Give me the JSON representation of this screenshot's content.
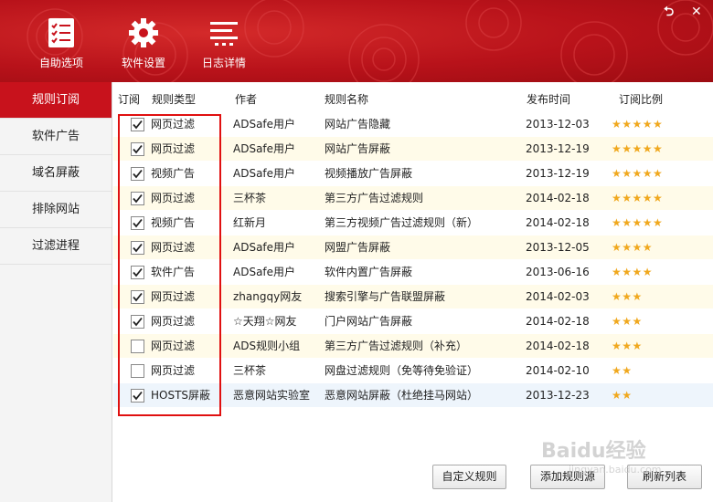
{
  "window": {
    "controls": {
      "restore": "⮌",
      "close": "✕"
    }
  },
  "toolbar": {
    "buttons": [
      {
        "label": "自助选项",
        "icon": "checklist-icon"
      },
      {
        "label": "软件设置",
        "icon": "gear-icon"
      },
      {
        "label": "日志详情",
        "icon": "list-log-icon"
      }
    ]
  },
  "sidebar": {
    "items": [
      {
        "label": "规则订阅",
        "active": true
      },
      {
        "label": "软件广告",
        "active": false
      },
      {
        "label": "域名屏蔽",
        "active": false
      },
      {
        "label": "排除网站",
        "active": false
      },
      {
        "label": "过滤进程",
        "active": false
      }
    ]
  },
  "table": {
    "headers": [
      "订阅",
      "规则类型",
      "作者",
      "规则名称",
      "发布时间",
      "订阅比例"
    ],
    "rows": [
      {
        "checked": true,
        "type": "网页过滤",
        "author": "ADSafe用户",
        "name": "网站广告隐藏",
        "date": "2013-12-03",
        "rating": "★★★★★"
      },
      {
        "checked": true,
        "type": "网页过滤",
        "author": "ADSafe用户",
        "name": "网站广告屏蔽",
        "date": "2013-12-19",
        "rating": "★★★★★"
      },
      {
        "checked": true,
        "type": "视频广告",
        "author": "ADSafe用户",
        "name": "视频播放广告屏蔽",
        "date": "2013-12-19",
        "rating": "★★★★★"
      },
      {
        "checked": true,
        "type": "网页过滤",
        "author": "三杯茶",
        "name": "第三方广告过滤规则",
        "date": "2014-02-18",
        "rating": "★★★★★"
      },
      {
        "checked": true,
        "type": "视频广告",
        "author": "红新月",
        "name": "第三方视频广告过滤规则（新）",
        "date": "2014-02-18",
        "rating": "★★★★★"
      },
      {
        "checked": true,
        "type": "网页过滤",
        "author": "ADSafe用户",
        "name": "网盟广告屏蔽",
        "date": "2013-12-05",
        "rating": "★★★★"
      },
      {
        "checked": true,
        "type": "软件广告",
        "author": "ADSafe用户",
        "name": "软件内置广告屏蔽",
        "date": "2013-06-16",
        "rating": "★★★★"
      },
      {
        "checked": true,
        "type": "网页过滤",
        "author": "zhangqy网友",
        "name": "搜索引擎与广告联盟屏蔽",
        "date": "2014-02-03",
        "rating": "★★★"
      },
      {
        "checked": true,
        "type": "网页过滤",
        "author": "☆天翔☆网友",
        "name": "门户网站广告屏蔽",
        "date": "2014-02-18",
        "rating": "★★★"
      },
      {
        "checked": false,
        "type": "网页过滤",
        "author": "ADS规则小组",
        "name": "第三方广告过滤规则（补充）",
        "date": "2014-02-18",
        "rating": "★★★"
      },
      {
        "checked": false,
        "type": "网页过滤",
        "author": "三杯茶",
        "name": "网盘过滤规则（免等待免验证）",
        "date": "2014-02-10",
        "rating": "★★"
      },
      {
        "checked": true,
        "type": "HOSTS屏蔽",
        "author": "恶意网站实验室",
        "name": "恶意网站屏蔽（杜绝挂马网站）",
        "date": "2013-12-23",
        "rating": "★★"
      }
    ]
  },
  "footer": {
    "custom_rule": "自定义规则",
    "add_source": "添加规则源",
    "refresh": "刷新列表"
  },
  "watermark": {
    "text": "Baidu经验",
    "sub": "jingyan.baidu.com"
  },
  "colors": {
    "brand_red": "#c8121c",
    "star": "#f0a81e",
    "highlight_border": "#e01010"
  }
}
